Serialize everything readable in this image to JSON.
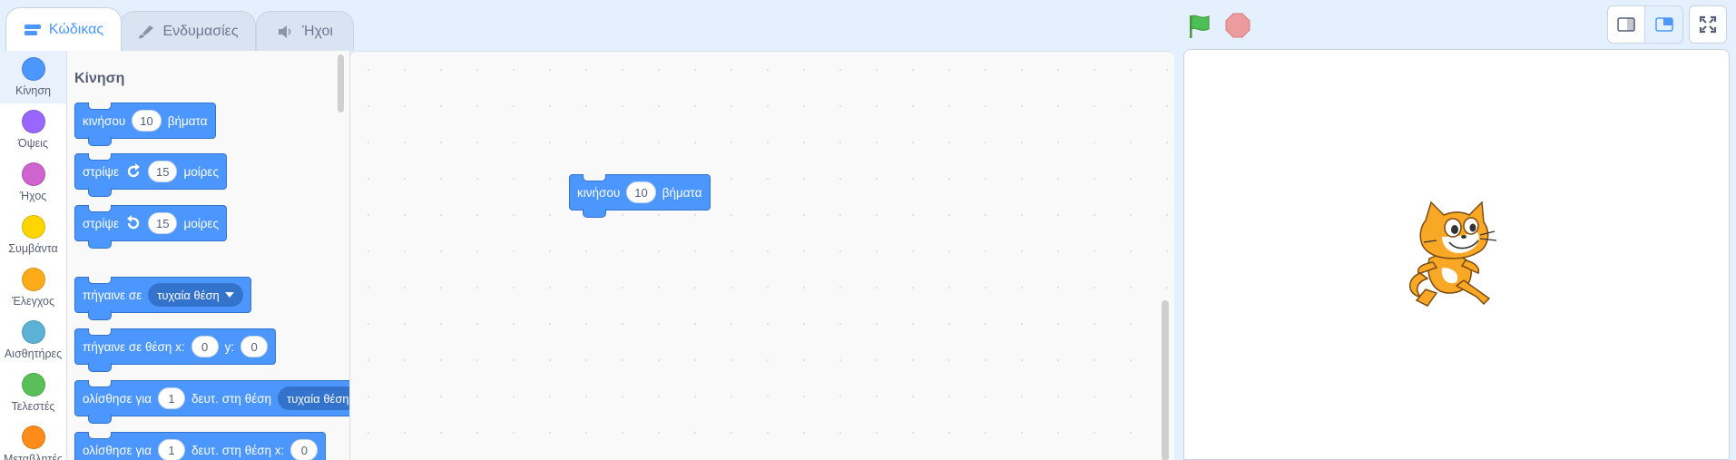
{
  "tabs": [
    {
      "label": "Κώδικας",
      "icon": "code-icon",
      "active": true
    },
    {
      "label": "Ενδυμασίες",
      "icon": "brush-icon",
      "active": false
    },
    {
      "label": "Ήχοι",
      "icon": "speaker-icon",
      "active": false
    }
  ],
  "controls": {
    "flag_icon": "green-flag-icon",
    "stop_icon": "stop-icon"
  },
  "stage_buttons": [
    "small-stage-icon",
    "normal-stage-icon",
    "fullscreen-icon"
  ],
  "categories": [
    {
      "label": "Κίνηση",
      "color": "#4c97ff",
      "selected": true
    },
    {
      "label": "Όψεις",
      "color": "#9966ff"
    },
    {
      "label": "Ήχος",
      "color": "#cf63cf"
    },
    {
      "label": "Συμβάντα",
      "color": "#ffd500"
    },
    {
      "label": "Έλεγχος",
      "color": "#ffab19"
    },
    {
      "label": "Αισθητήρες",
      "color": "#5cb1d6"
    },
    {
      "label": "Τελεστές",
      "color": "#59c059"
    },
    {
      "label": "Μεταβλητές",
      "color": "#ff8c1a"
    }
  ],
  "palette": {
    "title": "Κίνηση",
    "blocks": {
      "move": {
        "pre": "κινήσου",
        "value": "10",
        "post": "βήματα"
      },
      "turn_right": {
        "pre": "στρίψε",
        "value": "15",
        "post": "μοίρες"
      },
      "turn_left": {
        "pre": "στρίψε",
        "value": "15",
        "post": "μοίρες"
      },
      "goto": {
        "pre": "πήγαινε σε",
        "option": "τυχαία θέση"
      },
      "goto_xy": {
        "pre": "πήγαινε σε θέση x:",
        "x": "0",
        "ylabel": "y:",
        "y": "0"
      },
      "glide": {
        "pre": "ολίσθησε για",
        "value": "1",
        "mid": "δευτ. στη θέση",
        "option": "τυχαία θέση"
      },
      "glide_xy": {
        "pre": "ολίσθησε για",
        "value": "1",
        "mid": "δευτ. στη θέση x:",
        "x": "0"
      }
    }
  },
  "workspace": {
    "block": {
      "pre": "κινήσου",
      "value": "10",
      "post": "βήματα"
    }
  },
  "colors": {
    "motion": "#4c97ff",
    "motion_dark": "#3373cc"
  }
}
